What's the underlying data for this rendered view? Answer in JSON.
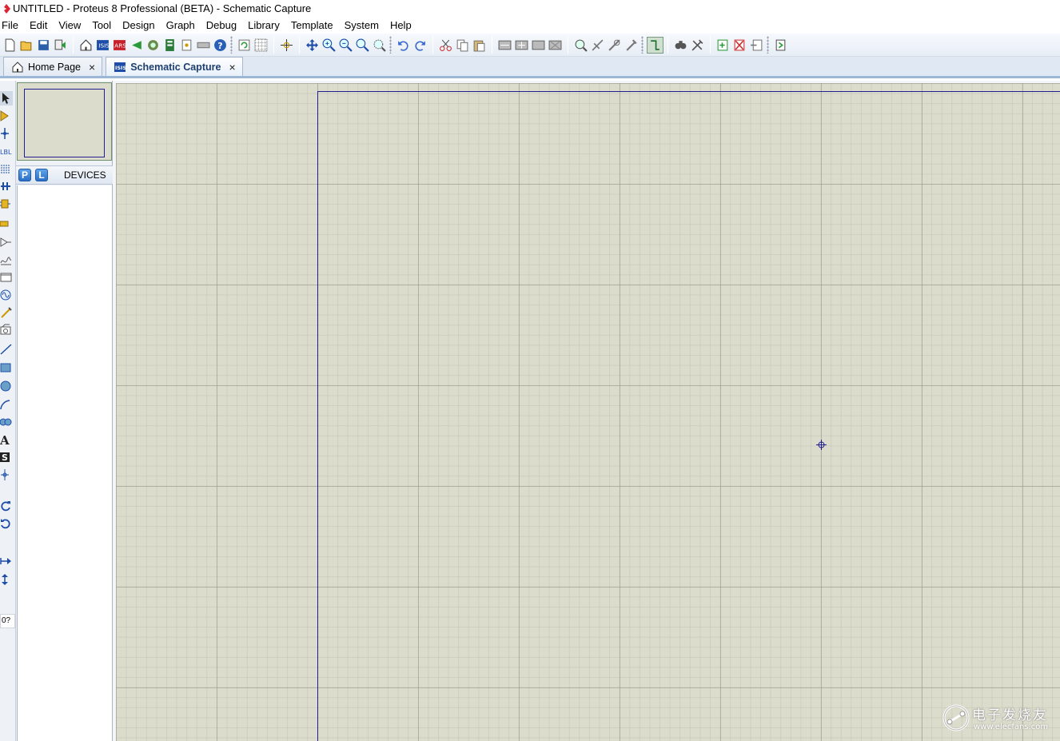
{
  "window": {
    "title": "UNTITLED - Proteus 8 Professional (BETA) - Schematic Capture"
  },
  "menu": [
    "File",
    "Edit",
    "View",
    "Tool",
    "Design",
    "Graph",
    "Debug",
    "Library",
    "Template",
    "System",
    "Help"
  ],
  "tabs": [
    {
      "label": "Home Page",
      "icon": "home-icon",
      "close": "×",
      "active": false
    },
    {
      "label": "Schematic Capture",
      "icon": "schematic-icon",
      "close": "×",
      "active": true
    }
  ],
  "toolbar": {
    "icons": [
      "new-icon",
      "open-icon",
      "save-icon",
      "import-icon",
      "home-icon",
      "schematic-icon",
      "pcb-icon",
      "gerber-icon",
      "3d-icon",
      "bom-icon",
      "design-explorer-icon",
      "tape-icon",
      "help-icon",
      "refresh-icon",
      "grid-icon",
      "origin-icon",
      "pan-icon",
      "zoom-in-icon",
      "zoom-out-icon",
      "zoom-all-icon",
      "zoom-area-icon",
      "undo-icon",
      "redo-icon",
      "cut-icon",
      "copy-icon",
      "paste-icon",
      "block-copy-icon",
      "block-move-icon",
      "block-rotate-icon",
      "block-delete-icon",
      "pick-parts-icon",
      "make-device-icon",
      "packaging-icon",
      "decompose-icon",
      "wire-autorouter-icon",
      "search-icon",
      "property-assignment-icon",
      "new-sheet-icon",
      "remove-sheet-icon",
      "exit-sheet-icon",
      "netlist-icon"
    ]
  },
  "sidepanel": {
    "pick_p": "P",
    "pick_l": "L",
    "devices_label": "DEVICES"
  },
  "leftstrip": {
    "rotation_value": "0?"
  },
  "watermark": {
    "line1": "电子发烧友",
    "line2": "www.elecfans.com"
  },
  "colors": {
    "canvas": "#dcdccc",
    "sheet_border": "#202090",
    "tabbar": "#dfe8f3"
  }
}
